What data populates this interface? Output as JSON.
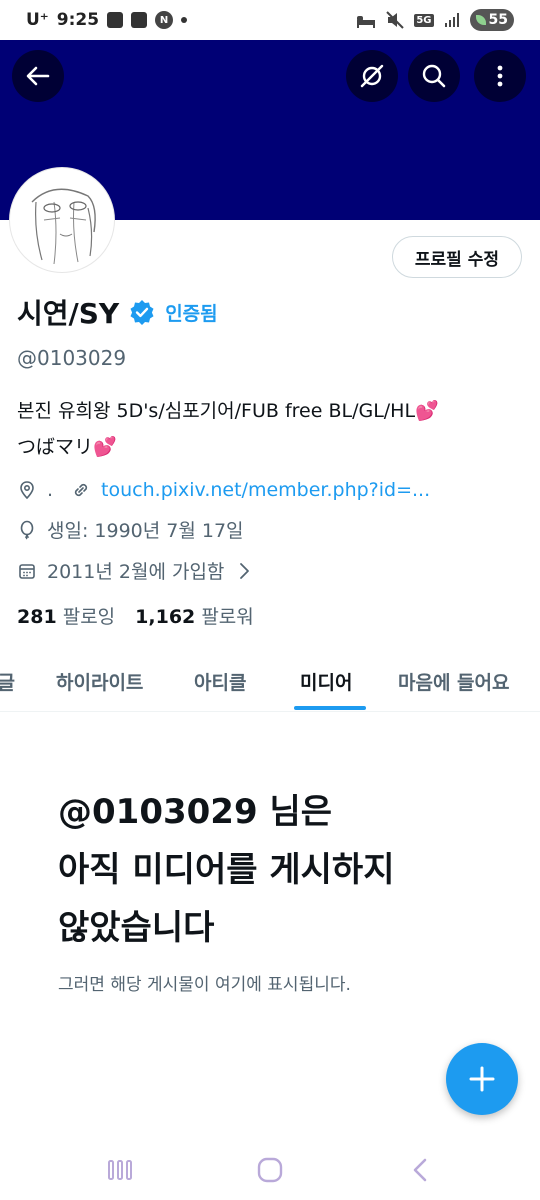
{
  "status_bar": {
    "carrier": "U⁺",
    "time": "9:25",
    "network": "5G",
    "battery": "55"
  },
  "header": {
    "banner_color": "#000075"
  },
  "profile": {
    "edit_button": "프로필 수정",
    "display_name": "시연/SY",
    "verified_label": "인증됨",
    "handle": "@0103029",
    "bio_line1": "본진 유희왕 5D's/심포기어/FUB free BL/GL/HL",
    "bio_line2": "つばマリ",
    "location": ".",
    "website": "touch.pixiv.net/member.php?id=...",
    "birthday": "생일: 1990년 7월 17일",
    "joined": "2011년 2월에 가입함",
    "following_count": "281",
    "following_label": "팔로잉",
    "followers_count": "1,162",
    "followers_label": "팔로워"
  },
  "tabs": [
    {
      "label": "답글"
    },
    {
      "label": "하이라이트"
    },
    {
      "label": "아티클"
    },
    {
      "label": "미디어"
    },
    {
      "label": "마음에 들어요"
    }
  ],
  "empty_state": {
    "title_line1": "@0103029 님은",
    "title_line2": "아직 미디어를 게시하지",
    "title_line3": "않았습니다",
    "subtitle": "그러면 해당 게시물이 여기에 표시됩니다."
  },
  "colors": {
    "accent": "#1d9bf0",
    "heart": "#ff5ec8"
  }
}
